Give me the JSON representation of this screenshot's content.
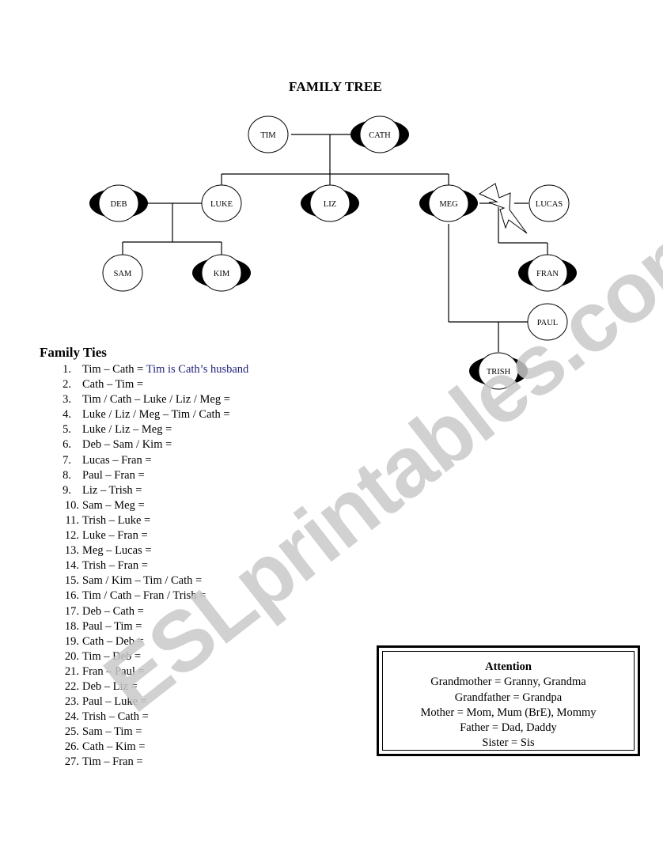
{
  "title": "FAMILY TREE",
  "tree": {
    "nodes": [
      {
        "id": "tim",
        "label": "TIM",
        "gender": "male"
      },
      {
        "id": "cath",
        "label": "CATH",
        "gender": "female"
      },
      {
        "id": "deb",
        "label": "DEB",
        "gender": "female"
      },
      {
        "id": "luke",
        "label": "LUKE",
        "gender": "male"
      },
      {
        "id": "liz",
        "label": "LIZ",
        "gender": "female"
      },
      {
        "id": "meg",
        "label": "MEG",
        "gender": "female"
      },
      {
        "id": "lucas",
        "label": "LUCAS",
        "gender": "male"
      },
      {
        "id": "sam",
        "label": "SAM",
        "gender": "male"
      },
      {
        "id": "kim",
        "label": "KIM",
        "gender": "female"
      },
      {
        "id": "fran",
        "label": "FRAN",
        "gender": "female"
      },
      {
        "id": "paul",
        "label": "PAUL",
        "gender": "male"
      },
      {
        "id": "trish",
        "label": "TRISH",
        "gender": "female"
      }
    ],
    "couples": [
      {
        "partners": [
          "tim",
          "cath"
        ],
        "children": [
          "luke",
          "liz",
          "meg"
        ]
      },
      {
        "partners": [
          "deb",
          "luke"
        ],
        "children": [
          "sam",
          "kim"
        ]
      },
      {
        "partners": [
          "meg",
          "lucas"
        ],
        "status": "divorced",
        "children": [
          "fran"
        ]
      },
      {
        "partners": [
          "meg",
          "paul"
        ],
        "children": [
          "trish"
        ]
      }
    ]
  },
  "ties": {
    "heading": "Family Ties",
    "items": [
      {
        "num": "1.",
        "question": "Tim – Cath = ",
        "answer": "Tim is Cath’s husband"
      },
      {
        "num": "2.",
        "question": "Cath – Tim =",
        "answer": ""
      },
      {
        "num": "3.",
        "question": "Tim / Cath – Luke / Liz / Meg =",
        "answer": ""
      },
      {
        "num": "4.",
        "question": "Luke / Liz / Meg – Tim / Cath =",
        "answer": ""
      },
      {
        "num": "5.",
        "question": "Luke / Liz – Meg =",
        "answer": ""
      },
      {
        "num": "6.",
        "question": "Deb – Sam / Kim =",
        "answer": ""
      },
      {
        "num": "7.",
        "question": "Lucas – Fran =",
        "answer": ""
      },
      {
        "num": "8.",
        "question": "Paul – Fran =",
        "answer": ""
      },
      {
        "num": "9.",
        "question": "Liz – Trish =",
        "answer": ""
      },
      {
        "num": "10.",
        "question": "Sam – Meg =",
        "answer": ""
      },
      {
        "num": "11.",
        "question": "Trish – Luke =",
        "answer": ""
      },
      {
        "num": "12.",
        "question": "Luke – Fran =",
        "answer": ""
      },
      {
        "num": "13.",
        "question": "Meg – Lucas =",
        "answer": ""
      },
      {
        "num": "14.",
        "question": "Trish – Fran =",
        "answer": ""
      },
      {
        "num": "15.",
        "question": "Sam / Kim – Tim / Cath =",
        "answer": ""
      },
      {
        "num": "16.",
        "question": "Tim / Cath – Fran / Trish =",
        "answer": ""
      },
      {
        "num": "17.",
        "question": "Deb – Cath =",
        "answer": ""
      },
      {
        "num": "18.",
        "question": "Paul – Tim =",
        "answer": ""
      },
      {
        "num": "19.",
        "question": "Cath – Deb =",
        "answer": ""
      },
      {
        "num": "20.",
        "question": "Tim – Deb =",
        "answer": ""
      },
      {
        "num": "21.",
        "question": "Fran – Paul =",
        "answer": ""
      },
      {
        "num": "22.",
        "question": "Deb – Liz =",
        "answer": ""
      },
      {
        "num": "23.",
        "question": "Paul – Luke =",
        "answer": ""
      },
      {
        "num": "24.",
        "question": "Trish – Cath =",
        "answer": ""
      },
      {
        "num": "25.",
        "question": "Sam – Tim =",
        "answer": ""
      },
      {
        "num": "26.",
        "question": "Cath – Kim =",
        "answer": ""
      },
      {
        "num": "27.",
        "question": "Tim – Fran =",
        "answer": ""
      }
    ]
  },
  "attention": {
    "heading": "Attention",
    "lines": [
      "Grandmother = Granny, Grandma",
      "Grandfather = Grandpa",
      "Mother = Mom, Mum (BrE), Mommy",
      "Father = Dad, Daddy",
      "Sister = Sis"
    ]
  },
  "watermark": "ESLprintables.com",
  "colors": {
    "answer": "#1f1f7a",
    "watermark": "#c9c9c9"
  }
}
